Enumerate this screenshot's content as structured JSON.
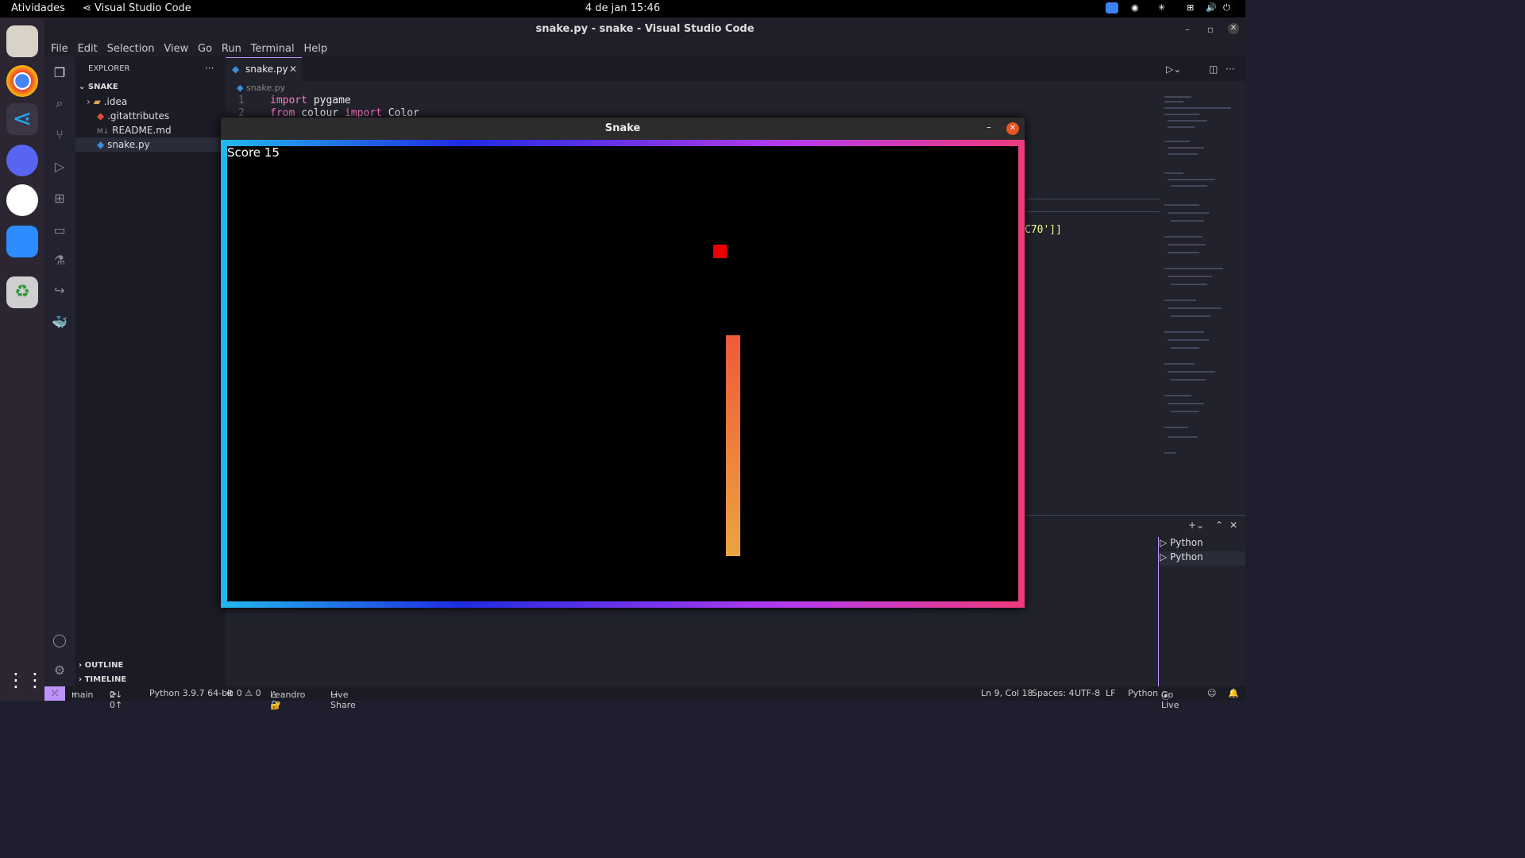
{
  "topbar": {
    "activities": "Atividades",
    "app_name": "Visual Studio Code",
    "clock": "4 de jan  15:46"
  },
  "window": {
    "title": "snake.py - snake - Visual Studio Code"
  },
  "menu": [
    "File",
    "Edit",
    "Selection",
    "View",
    "Go",
    "Run",
    "Terminal",
    "Help"
  ],
  "sidebar": {
    "header": "EXPLORER",
    "more": "···",
    "folder": "SNAKE",
    "files": [
      {
        "name": ".idea",
        "kind": "folder"
      },
      {
        "name": ".gitattributes",
        "kind": "git"
      },
      {
        "name": "README.md",
        "kind": "md"
      },
      {
        "name": "snake.py",
        "kind": "python"
      }
    ],
    "outline": "OUTLINE",
    "timeline": "TIMELINE"
  },
  "editor": {
    "tab_label": "snake.py",
    "breadcrumb": "snake.py",
    "lines": [
      {
        "num": "1",
        "kw": "import",
        "rest": " pygame"
      },
      {
        "num": "2",
        "kw": "from",
        "rest": " colour ",
        "kw2": "import",
        "rest2": " Color"
      }
    ],
    "snippet": "C70']]"
  },
  "snake_window": {
    "title": "Snake",
    "score": "Score 15",
    "food_color": "#ee0000",
    "snake_gradient_top": "#ee5a3a",
    "snake_gradient_bottom": "#eca440"
  },
  "panel": {
    "terminals": [
      "Python",
      "Python"
    ]
  },
  "statusbar": {
    "remote": "⤫",
    "branch": "main",
    "sync": "2↓ 0↑",
    "interpreter": "Python 3.9.7 64-bit",
    "problems": "⊗ 0 ⚠ 0",
    "user": "Leandro 🔐",
    "liveshare": "Live Share",
    "position": "Ln 9, Col 18",
    "spaces": "Spaces: 4",
    "encoding": "UTF-8",
    "eol": "LF",
    "language": "Python",
    "golive": "Go Live"
  }
}
